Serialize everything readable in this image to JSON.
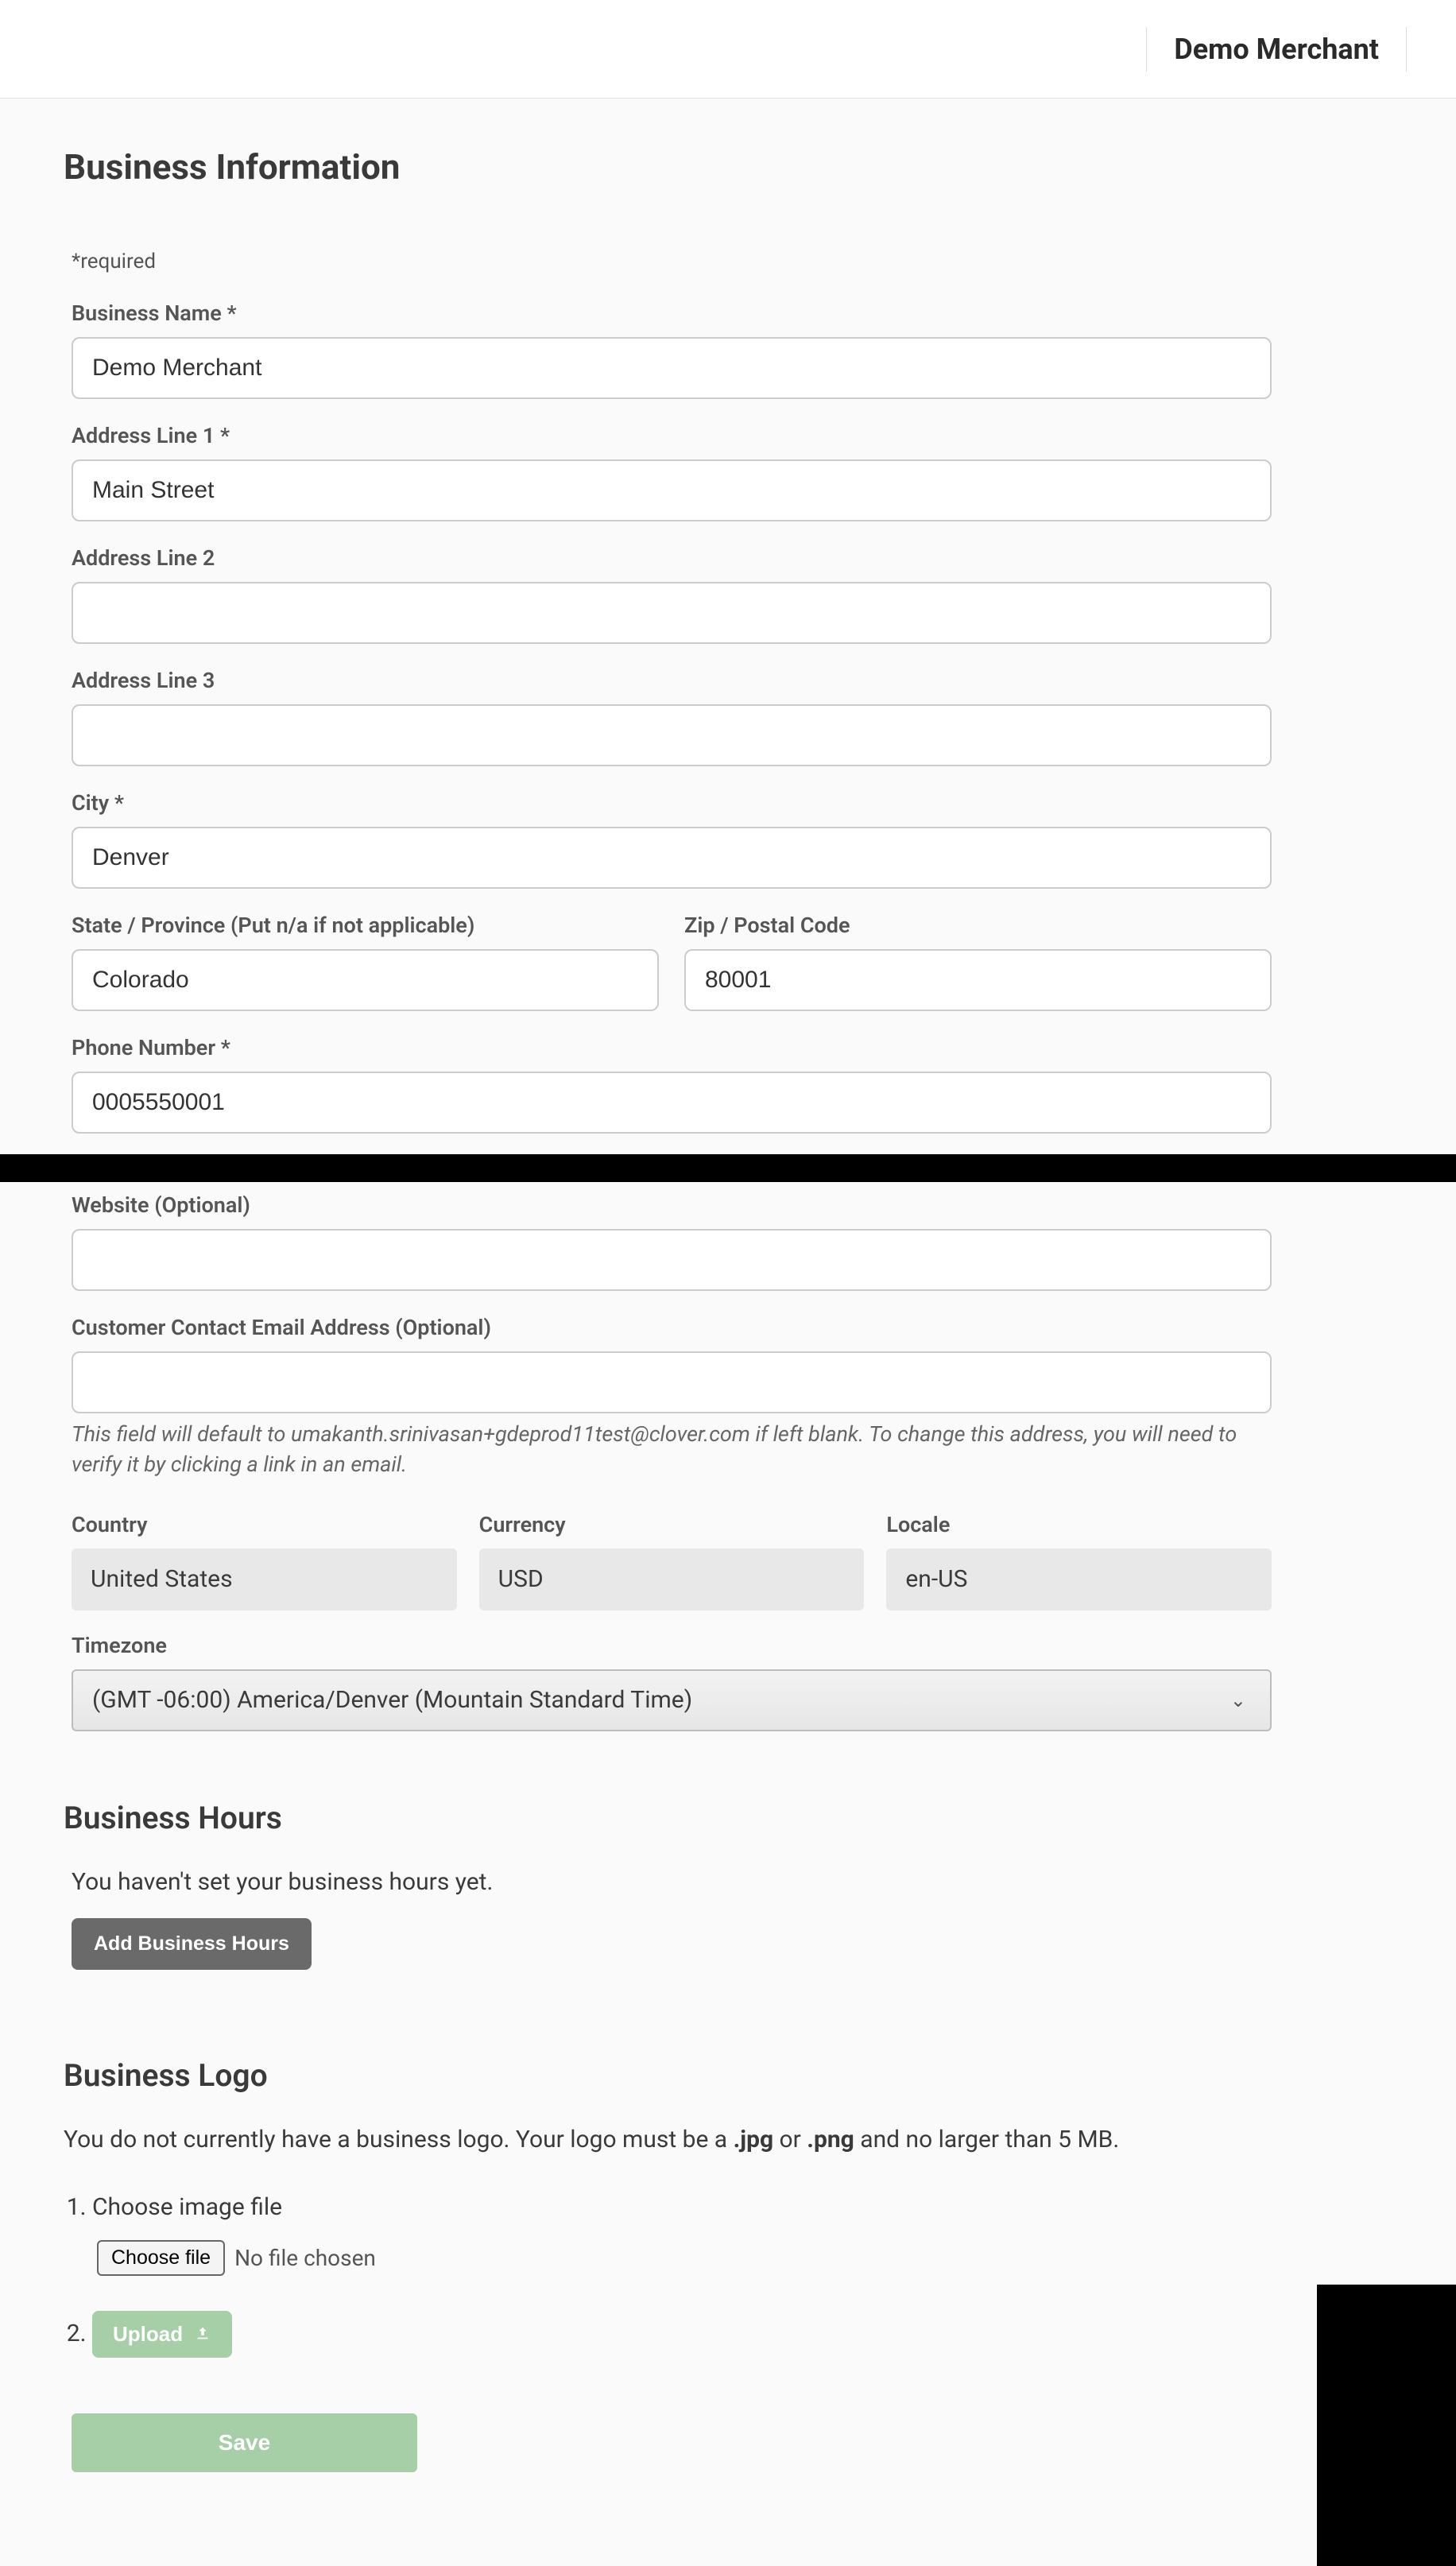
{
  "header": {
    "merchant_name": "Demo Merchant"
  },
  "page": {
    "title": "Business Information",
    "required_note": "*required"
  },
  "form": {
    "business_name": {
      "label": "Business Name *",
      "value": "Demo Merchant"
    },
    "address1": {
      "label": "Address Line 1 *",
      "value": "Main Street"
    },
    "address2": {
      "label": "Address Line 2",
      "value": ""
    },
    "address3": {
      "label": "Address Line 3",
      "value": ""
    },
    "city": {
      "label": "City *",
      "value": "Denver"
    },
    "state": {
      "label": "State / Province (Put n/a if not applicable)",
      "value": "Colorado"
    },
    "zip": {
      "label": "Zip / Postal Code",
      "value": "80001"
    },
    "phone": {
      "label": "Phone Number *",
      "value": "0005550001"
    },
    "website": {
      "label": "Website (Optional)",
      "value": ""
    },
    "email": {
      "label": "Customer Contact Email Address (Optional)",
      "value": "",
      "helper": "This field will default to umakanth.srinivasan+gdeprod11test@clover.com if left blank. To change this address, you will need to verify it by clicking a link in an email."
    },
    "country": {
      "label": "Country",
      "value": "United States"
    },
    "currency": {
      "label": "Currency",
      "value": "USD"
    },
    "locale": {
      "label": "Locale",
      "value": "en-US"
    },
    "timezone": {
      "label": "Timezone",
      "value": "(GMT -06:00) America/Denver (Mountain Standard Time)"
    }
  },
  "hours": {
    "title": "Business Hours",
    "empty_text": "You haven't set your business hours yet.",
    "add_button": "Add Business Hours"
  },
  "logo": {
    "title": "Business Logo",
    "desc_pre": "You do not currently have a business logo. Your logo must be a ",
    "jpg": ".jpg",
    "or": " or ",
    "png": ".png",
    "desc_post": " and no larger than 5 MB.",
    "step1": "Choose image file",
    "choose_btn": "Choose file",
    "no_file": "No file chosen",
    "upload_btn": "Upload"
  },
  "actions": {
    "save": "Save"
  }
}
